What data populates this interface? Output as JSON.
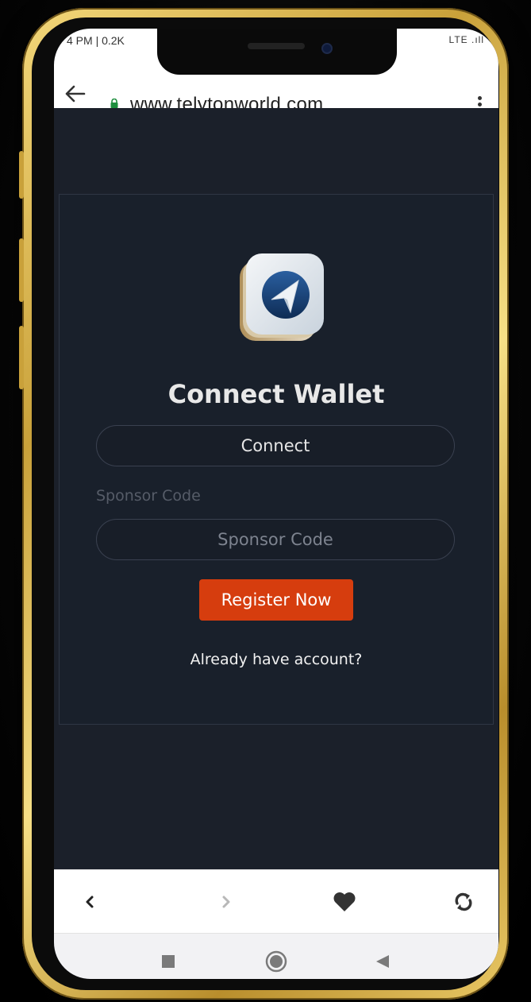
{
  "status_bar": {
    "time": "4 PM | 0.2K",
    "icons": "LTE .ıll"
  },
  "browser": {
    "url": "www.telytonworld.com",
    "icons": {
      "back": "arrow-left-icon",
      "secure": "lock-icon",
      "menu": "more-vertical-icon"
    }
  },
  "page": {
    "title": "Connect Wallet",
    "connect_label": "Connect",
    "sponsor_label": "Sponsor Code",
    "sponsor_placeholder": "Sponsor Code",
    "register_label": "Register Now",
    "already_label": "Already have account?"
  },
  "bottom_toolbar": {
    "back_icon": "chevron-left-icon",
    "forward_icon": "chevron-right-icon",
    "favorite_icon": "heart-icon",
    "refresh_icon": "refresh-icon"
  },
  "system_nav": {
    "recents_icon": "square-icon",
    "home_icon": "circle-icon",
    "back_icon": "triangle-back-icon"
  },
  "colors": {
    "background": "#1b202a",
    "card": "#19202b",
    "accent": "#d63d0e",
    "frame_gold": "#d4af4a",
    "secure_lock": "#1e8e3e"
  }
}
